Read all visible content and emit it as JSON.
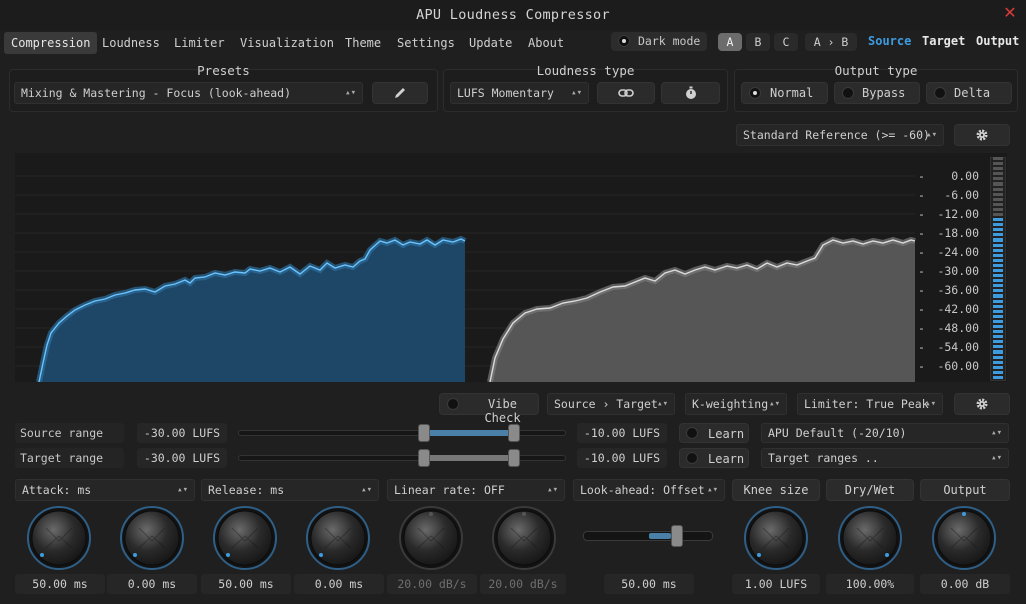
{
  "window": {
    "title": "APU Loudness Compressor"
  },
  "menu": {
    "items": [
      "Compression",
      "Loudness",
      "Limiter",
      "Visualization",
      "Theme",
      "Settings",
      "Update",
      "About"
    ],
    "dark_mode": "Dark mode",
    "ab_buttons": [
      "A",
      "B",
      "C",
      "A › B"
    ],
    "views": [
      "Source",
      "Target",
      "Output"
    ]
  },
  "presets": {
    "title": "Presets",
    "selected": "Mixing & Mastering - Focus (look-ahead)"
  },
  "loudness_type": {
    "title": "Loudness type",
    "selected": "LUFS Momentary"
  },
  "output_type": {
    "title": "Output type",
    "options": [
      "Normal",
      "Bypass",
      "Delta"
    ]
  },
  "reference": {
    "selected": "Standard Reference (>= -60)"
  },
  "scale": {
    "ticks": [
      "0.00",
      "-6.00",
      "-12.00",
      "-18.00",
      "-24.00",
      "-30.00",
      "-36.00",
      "-42.00",
      "-48.00",
      "-54.00",
      "-60.00"
    ],
    "meter_level": 0.72
  },
  "toolbar": {
    "vibe_check": "Vibe Check",
    "mode": "Source › Target",
    "weighting": "K-weighting",
    "limiter": "Limiter: True Peak"
  },
  "source_range": {
    "label": "Source range",
    "low": "-30.00 LUFS",
    "high": "-10.00 LUFS",
    "learn": "Learn",
    "preset": "APU Default (-20/10)",
    "low_value": -30,
    "high_value": -10
  },
  "target_range": {
    "label": "Target range",
    "low": "-30.00 LUFS",
    "high": "-10.00 LUFS",
    "learn": "Learn",
    "preset": "Target ranges ..",
    "low_value": -30,
    "high_value": -10
  },
  "params": {
    "attack": "Attack: ms",
    "release": "Release: ms",
    "linear_rate": "Linear rate: OFF",
    "lookahead": "Look-ahead: Offset",
    "knee": "Knee size",
    "drywet": "Dry/Wet",
    "output": "Output"
  },
  "knobs": {
    "values": [
      "50.00 ms",
      "0.00 ms",
      "50.00 ms",
      "0.00 ms",
      "20.00 dB/s",
      "20.00 dB/s",
      "50.00 ms",
      "1.00 LUFS",
      "100.00%",
      "0.00 dB"
    ]
  },
  "colors": {
    "accent": "#3d9be0",
    "source_fill": "#1f4a6d",
    "target_fill": "#5a5a5a"
  }
}
